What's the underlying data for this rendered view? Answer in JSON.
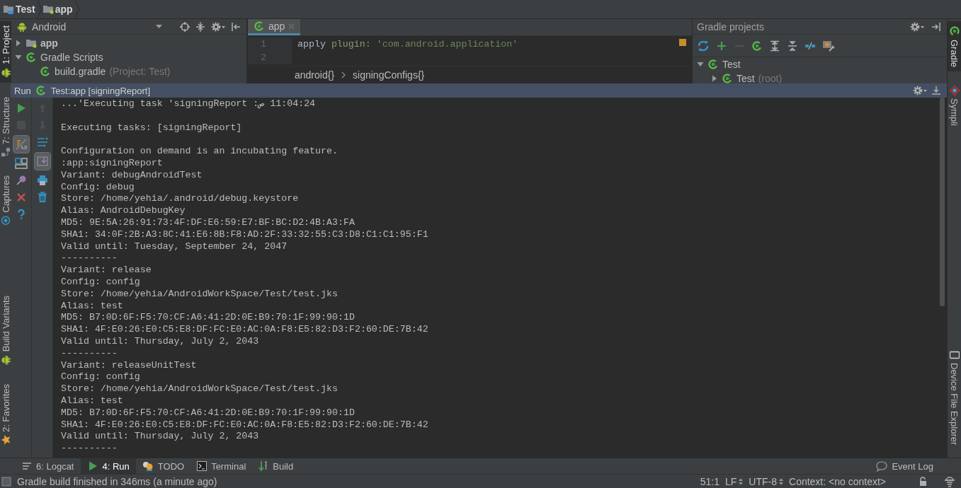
{
  "breadcrumbs": [
    {
      "label": "Test",
      "kind": "project"
    },
    {
      "label": "app",
      "kind": "module"
    }
  ],
  "left_tool_strip": {
    "top": [
      {
        "label": "1: Project",
        "kind": "project",
        "selected": true
      },
      {
        "label": "7: Structure",
        "kind": "structure",
        "selected": false
      },
      {
        "label": "Captures",
        "kind": "captures",
        "selected": false
      }
    ],
    "bottom": [
      {
        "label": "Build Variants",
        "kind": "variants",
        "selected": false
      },
      {
        "label": "2: Favorites",
        "kind": "favorites",
        "selected": false
      }
    ]
  },
  "project_panel": {
    "view": "Android",
    "tree": [
      {
        "label": "app",
        "kind": "module",
        "expanded": false
      },
      {
        "label": "Gradle Scripts",
        "kind": "gradle",
        "expanded": true,
        "children": [
          {
            "label": "build.gradle",
            "kind": "gradle",
            "note": "(Project: Test)"
          }
        ]
      }
    ]
  },
  "editor": {
    "tabs": [
      {
        "label": "app",
        "selected": true
      }
    ],
    "lines": [
      {
        "number": "1",
        "tokens": [
          {
            "kind": "plain",
            "text": "apply"
          },
          {
            "kind": "param",
            "text": "plugin:"
          },
          {
            "kind": "string",
            "text": "'com.android.application'"
          }
        ]
      },
      {
        "number": "2"
      }
    ],
    "breadcrumbs": [
      "android{}",
      "signingConfigs{}"
    ]
  },
  "gradle_panel": {
    "title": "Gradle projects",
    "toolbar": [
      {
        "kind": "refresh",
        "disabled": false
      },
      {
        "kind": "add",
        "disabled": false
      },
      {
        "kind": "remove",
        "disabled": true
      },
      {
        "kind": "execute",
        "disabled": false
      },
      {
        "kind": "expand",
        "disabled": false
      },
      {
        "kind": "collapse",
        "disabled": false
      },
      {
        "kind": "offline",
        "disabled": false
      },
      {
        "kind": "settings",
        "disabled": false
      }
    ],
    "tree": [
      {
        "label": "Test",
        "kind": "gradle",
        "expanded": true,
        "children": [
          {
            "label": "Test",
            "note": "(root)",
            "kind": "gradle",
            "expanded": false
          }
        ]
      }
    ]
  },
  "right_tool_strip": {
    "top": [
      {
        "label": "Gradle",
        "kind": "gradle",
        "selected": true
      },
      {
        "label": "Sympli",
        "kind": "sympli",
        "selected": false
      }
    ],
    "bottom": [
      {
        "label": "Device File Explorer",
        "kind": "device",
        "selected": false
      }
    ]
  },
  "run_panel": {
    "title": "Run",
    "configuration": "Test:app [signingReport]",
    "left_toolbar": [
      {
        "kind": "run",
        "disabled": false
      },
      {
        "kind": "stop",
        "disabled": true
      },
      {
        "kind": "wrap",
        "selected": true
      },
      {
        "kind": "layout"
      },
      {
        "kind": "pin"
      },
      {
        "kind": "close"
      },
      {
        "kind": "help"
      }
    ],
    "right_toolbar": [
      {
        "kind": "up",
        "disabled": true
      },
      {
        "kind": "down",
        "disabled": true
      },
      {
        "kind": "sort"
      },
      {
        "kind": "scroll-end",
        "selected": true
      },
      {
        "kind": "print"
      },
      {
        "kind": "trash"
      }
    ],
    "console": [
      [
        "...'Executing task 'signingReport :ص 11:04:24"
      ],
      [
        "Executing tasks: [signingReport]"
      ],
      [
        "Configuration on demand is an incubating feature.",
        ":app:signingReport",
        "Variant: debugAndroidTest",
        "Config: debug",
        "Store: /home/yehia/.android/debug.keystore",
        "Alias: AndroidDebugKey",
        "MD5: 9E:5A:26:91:73:4F:DF:E6:59:E7:BF:BC:D2:4B:A3:FA",
        "SHA1: 34:0F:2B:A3:8C:41:E6:8B:F8:AD:2F:33:32:55:C3:D8:C1:C1:95:F1",
        "Valid until: Tuesday, September 24, 2047",
        "----------",
        "Variant: release",
        "Config: config",
        "Store: /home/yehia/AndroidWorkSpace/Test/test.jks",
        "Alias: test",
        "MD5: B7:0D:6F:F5:70:CF:A6:41:2D:0E:B9:70:1F:99:90:1D",
        "SHA1: 4F:E0:26:E0:C5:E8:DF:FC:E0:AC:0A:F8:E5:82:D3:F2:60:DE:7B:42",
        "Valid until: Thursday, July 2, 2043",
        "----------",
        "Variant: releaseUnitTest",
        "Config: config",
        "Store: /home/yehia/AndroidWorkSpace/Test/test.jks",
        "Alias: test",
        "MD5: B7:0D:6F:F5:70:CF:A6:41:2D:0E:B9:70:1F:99:90:1D",
        "SHA1: 4F:E0:26:E0:C5:E8:DF:FC:E0:AC:0A:F8:E5:82:D3:F2:60:DE:7B:42",
        "Valid until: Thursday, July 2, 2043",
        "----------"
      ]
    ]
  },
  "bottom_tabs": [
    {
      "label": "6: Logcat",
      "kind": "logcat",
      "selected": false
    },
    {
      "label": "4: Run",
      "kind": "run",
      "selected": true
    },
    {
      "label": "TODO",
      "kind": "todo",
      "selected": false
    },
    {
      "label": "Terminal",
      "kind": "terminal",
      "selected": false
    },
    {
      "label": "Build",
      "kind": "build",
      "selected": false
    }
  ],
  "event_log": "Event Log",
  "status_bar": {
    "message": "Gradle build finished in 346ms (a minute ago)",
    "position": "51:1",
    "line_separator": "LF",
    "encoding": "UTF-8",
    "context": "Context: <no context>"
  }
}
